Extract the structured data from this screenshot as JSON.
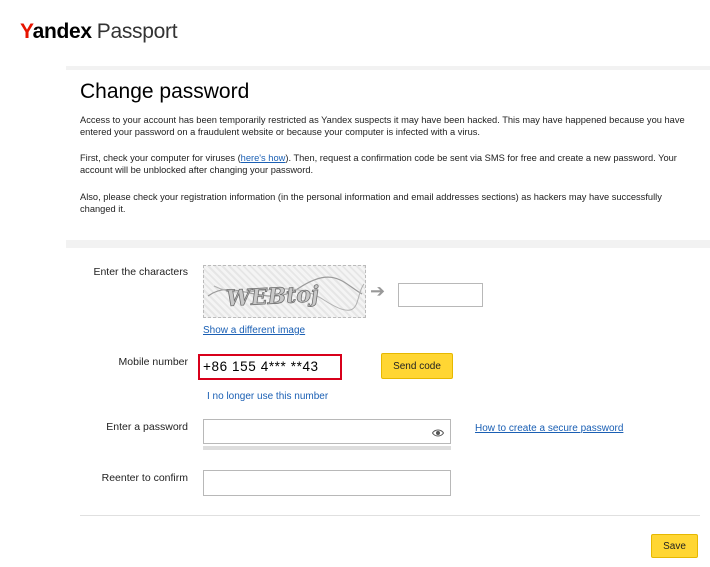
{
  "header": {
    "brand": "Yandex",
    "brand_first_letter": "Y",
    "brand_rest": "andex",
    "product": "Passport"
  },
  "main": {
    "title": "Change password",
    "paragraph1": "Access to your account has been temporarily restricted as Yandex suspects it may have been hacked. This may have happened because you have entered your password on a fraudulent website or because your computer is infected with a virus.",
    "paragraph2_before": "First, check your computer for viruses (",
    "paragraph2_link": "here's how",
    "paragraph2_after": "). Then, request a confirmation code be sent via SMS for free and create a new password. Your account will be unblocked after changing your password.",
    "paragraph3": "Also, please check your registration information (in the personal information and email addresses sections) as hackers may have successfully changed it."
  },
  "form": {
    "captcha_label": "Enter the characters",
    "captcha_text": "WEBtoj",
    "captcha_input_value": "",
    "show_different_image": "Show a different image",
    "mobile_label": "Mobile number",
    "mobile_value": "+86 155 4*** **43",
    "send_code": "Send code",
    "no_longer_use": "I no longer use this number",
    "password_label": "Enter a password",
    "password_value": "",
    "secure_password_link": "How to create a secure password",
    "confirm_label": "Reenter to confirm",
    "confirm_value": "",
    "save": "Save"
  },
  "colors": {
    "brand_red": "#e61400",
    "highlight_red": "#d8001b",
    "link_blue": "#1a5fb4",
    "button_yellow": "#ffd633"
  }
}
